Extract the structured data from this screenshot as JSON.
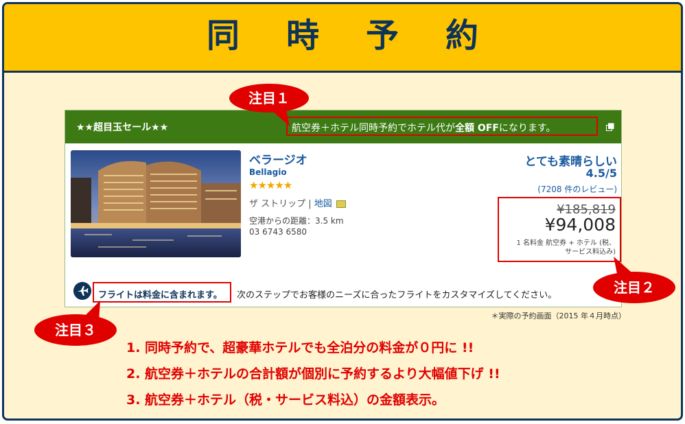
{
  "header": {
    "title": "同時予約"
  },
  "card": {
    "sale_label": "★★超目玉セール★★",
    "promo_prefix": "航空券＋ホテル同時予約でホテル代が",
    "promo_bold": "全額 OFF",
    "promo_suffix": "になります。",
    "hotel": {
      "name": "ベラージオ",
      "name_en": "Bellagio",
      "stars": "★★★★★",
      "area": "ザ ストリップ",
      "separator": " | ",
      "map_link": "地図",
      "distance": "空港からの距離：3.5 km",
      "phone": "03 6743 6580"
    },
    "rating": {
      "label": "とても素晴らしい",
      "score": "4.5/5",
      "reviews": "(7208 件のレビュー)"
    },
    "price": {
      "original": "¥185,819",
      "current": "¥94,008",
      "note_line1": "1 名料金  航空券 + ホテル (税、",
      "note_line2": "サービス料込み)"
    },
    "flight": {
      "highlight": "フライトは料金に含まれます。",
      "rest": "次のステップでお客様のニーズに合ったフライトをカスタマイズしてください。"
    }
  },
  "callouts": {
    "one": "注目１",
    "two": "注目２",
    "three": "注目３"
  },
  "footnote": "＊実際の予約画面（2015 年４月時点）",
  "points": [
    "1. 同時予約で、超豪華ホテルでも全泊分の料金が０円に !!",
    "2. 航空券＋ホテルの合計額が個別に予約するより大幅値下げ !!",
    "3. 航空券＋ホテル（税・サービス料込）の金額表示。"
  ],
  "colors": {
    "navy": "#0e3358",
    "yellow": "#ffc400",
    "cream": "#fff4cf",
    "green": "#3d7a14",
    "red": "#e00000",
    "link": "#1a5aa0"
  }
}
